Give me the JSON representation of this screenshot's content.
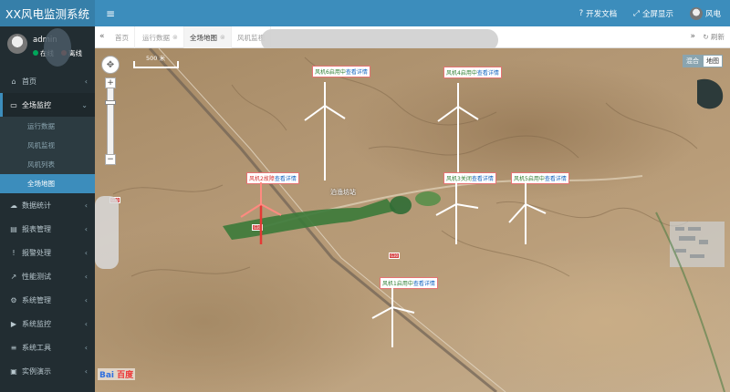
{
  "app": {
    "title": "XX风电监测系统"
  },
  "user": {
    "name": "admin",
    "status_online": "在线",
    "status_offline": "离线"
  },
  "sidebar": {
    "items": [
      {
        "label": "首页",
        "icon": "home-icon"
      },
      {
        "label": "全场监控",
        "icon": "monitor-icon"
      },
      {
        "label": "数据统计",
        "icon": "cloud-icon"
      },
      {
        "label": "报表管理",
        "icon": "document-icon"
      },
      {
        "label": "报警处理",
        "icon": "alarm-icon"
      },
      {
        "label": "性能测试",
        "icon": "chart-icon"
      },
      {
        "label": "系统管理",
        "icon": "gear-icon"
      },
      {
        "label": "系统监控",
        "icon": "video-icon"
      },
      {
        "label": "系统工具",
        "icon": "list-icon"
      },
      {
        "label": "实例演示",
        "icon": "screen-icon"
      }
    ],
    "submenu": [
      "运行数据",
      "风机监视",
      "风机列表",
      "全场地图"
    ]
  },
  "header": {
    "doc_label": "开发文档",
    "fullscreen_label": "全屏显示",
    "username": "风电"
  },
  "tabs": {
    "items": [
      "首页",
      "运行数据",
      "全场地图",
      "风机监视"
    ],
    "refresh_label": "刷新"
  },
  "map": {
    "scale_label": "500 米",
    "type_satellite": "混合",
    "type_map": "地图",
    "place_label": "泊渔坊站",
    "road_code": "G30",
    "baidu_logo": "Bai",
    "baidu_logo_suffix": "百度",
    "turbines": [
      {
        "name": "风机6",
        "status": "启用中",
        "link": "查看详情"
      },
      {
        "name": "风机4",
        "status": "启用中",
        "link": "查看详情"
      },
      {
        "name": "风机2",
        "status": "故障",
        "link": "查看详情"
      },
      {
        "name": "风机3",
        "status": "关闭",
        "link": "查看详情"
      },
      {
        "name": "风机5",
        "status": "启用中",
        "link": "查看详情"
      },
      {
        "name": "风机1",
        "status": "启用中",
        "link": "查看详情"
      }
    ]
  },
  "colors": {
    "header": "#3c8dbc",
    "sidebar": "#222d32",
    "active_sub": "#3c8dbc",
    "alarm": "#e53935"
  }
}
